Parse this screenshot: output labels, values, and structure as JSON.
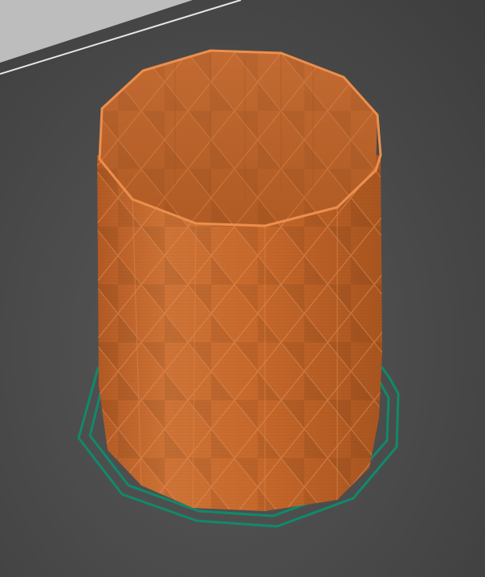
{
  "viewport": {
    "kind": "3d-slicer-preview",
    "background_color": "#4a4a4a",
    "bed_edge_color": "#bdbdbd"
  },
  "model": {
    "shape": "faceted-cylinder-vase",
    "pattern": "diamond-lattice",
    "color": "#c96a2e",
    "rim_color": "#e58848"
  },
  "skirt": {
    "shape": "polygon-outline",
    "color": "#0f8a6a"
  }
}
